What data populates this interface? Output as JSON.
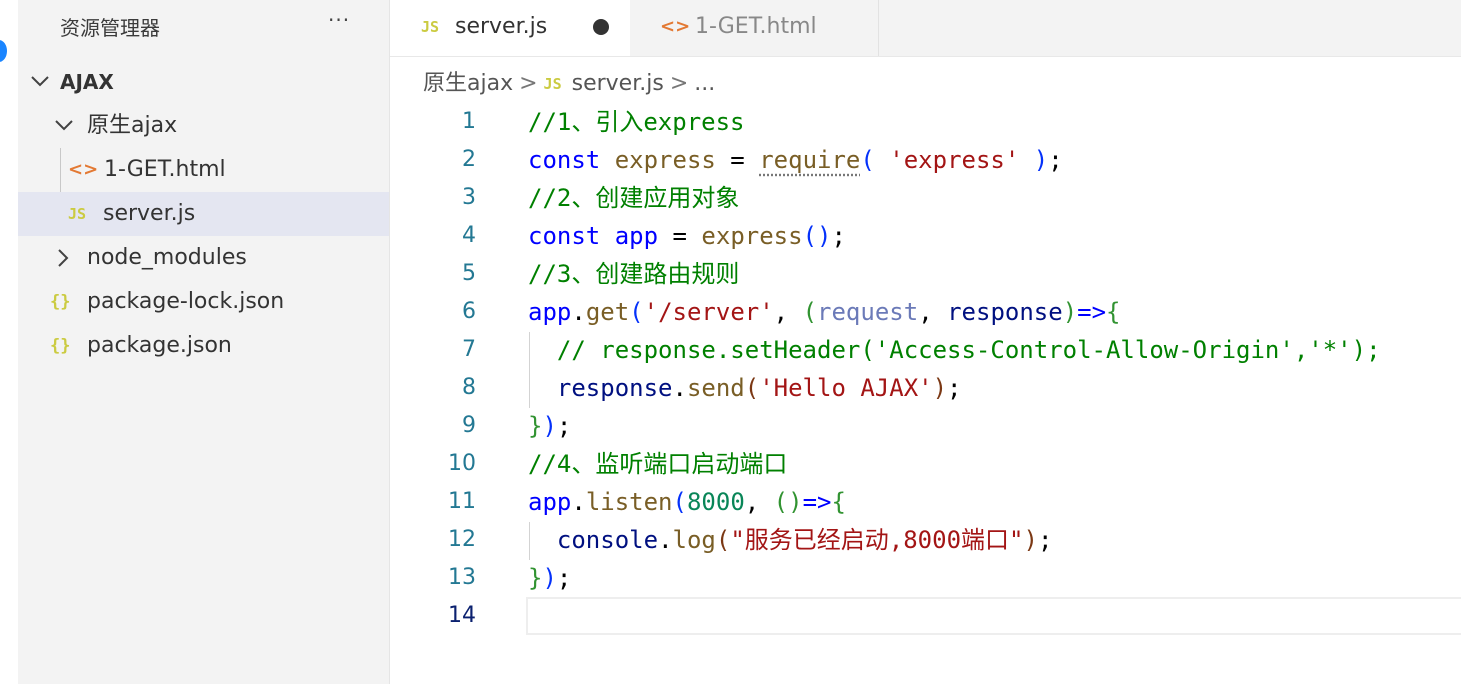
{
  "sidebar": {
    "title": "资源管理器",
    "more_label": "···",
    "tree": [
      {
        "label": "AJAX",
        "kind": "root-folder",
        "expanded": true
      },
      {
        "label": "原生ajax",
        "kind": "folder",
        "expanded": true
      },
      {
        "label": "1-GET.html",
        "kind": "file",
        "icon": "html-icon",
        "icon_glyph": "<>"
      },
      {
        "label": "server.js",
        "kind": "file",
        "icon": "js-icon",
        "icon_glyph": "JS",
        "selected": true
      },
      {
        "label": "node_modules",
        "kind": "folder",
        "expanded": false
      },
      {
        "label": "package-lock.json",
        "kind": "file",
        "icon": "json-icon",
        "icon_glyph": "{}"
      },
      {
        "label": "package.json",
        "kind": "file",
        "icon": "json-icon",
        "icon_glyph": "{}"
      }
    ]
  },
  "tabs": [
    {
      "label": "server.js",
      "icon_glyph": "JS",
      "active": true,
      "dirty": true
    },
    {
      "label": "1-GET.html",
      "icon_glyph": "<>",
      "active": false
    }
  ],
  "breadcrumb": {
    "folder": "原生ajax",
    "file_icon": "JS",
    "file": "server.js",
    "more": "..."
  },
  "editor": {
    "active_line": 14,
    "lines": [
      {
        "n": "1",
        "tokens": [
          [
            "c",
            "//1、引入express"
          ]
        ]
      },
      {
        "n": "2",
        "tokens": [
          [
            "k",
            "const"
          ],
          [
            "p",
            " "
          ],
          [
            "f",
            "express"
          ],
          [
            "p",
            " = "
          ],
          [
            "fsq",
            "require"
          ],
          [
            "b1",
            "("
          ],
          [
            "p",
            " "
          ],
          [
            "s",
            "'express'"
          ],
          [
            "p",
            " "
          ],
          [
            "b1",
            ")"
          ],
          [
            "p",
            ";"
          ]
        ]
      },
      {
        "n": "3",
        "tokens": [
          [
            "c",
            "//2、创建应用对象"
          ]
        ]
      },
      {
        "n": "4",
        "tokens": [
          [
            "k",
            "const"
          ],
          [
            "p",
            " "
          ],
          [
            "vk",
            "app"
          ],
          [
            "p",
            " = "
          ],
          [
            "f",
            "express"
          ],
          [
            "b1",
            "()"
          ],
          [
            "p",
            ";"
          ]
        ]
      },
      {
        "n": "5",
        "tokens": [
          [
            "c",
            "//3、创建路由规则"
          ]
        ]
      },
      {
        "n": "6",
        "tokens": [
          [
            "vk",
            "app"
          ],
          [
            "p",
            "."
          ],
          [
            "f",
            "get"
          ],
          [
            "b1",
            "("
          ],
          [
            "s",
            "'/server'"
          ],
          [
            "p",
            ", "
          ],
          [
            "b2",
            "("
          ],
          [
            "vdim",
            "request"
          ],
          [
            "p",
            ", "
          ],
          [
            "v",
            "response"
          ],
          [
            "b2",
            ")"
          ],
          [
            "k",
            "=>"
          ],
          [
            "b2",
            "{"
          ]
        ]
      },
      {
        "n": "7",
        "tokens": [
          [
            "p",
            "  "
          ],
          [
            "c",
            "// response.setHeader('Access-Control-Allow-Origin','*');"
          ]
        ]
      },
      {
        "n": "8",
        "tokens": [
          [
            "p",
            "  "
          ],
          [
            "v",
            "response"
          ],
          [
            "p",
            "."
          ],
          [
            "f",
            "send"
          ],
          [
            "b3",
            "("
          ],
          [
            "s",
            "'Hello AJAX'"
          ],
          [
            "b3",
            ")"
          ],
          [
            "p",
            ";"
          ]
        ]
      },
      {
        "n": "9",
        "tokens": [
          [
            "b2",
            "}"
          ],
          [
            "b1",
            ")"
          ],
          [
            "p",
            ";"
          ]
        ]
      },
      {
        "n": "10",
        "tokens": [
          [
            "c",
            "//4、监听端口启动端口"
          ]
        ]
      },
      {
        "n": "11",
        "tokens": [
          [
            "vk",
            "app"
          ],
          [
            "p",
            "."
          ],
          [
            "f",
            "listen"
          ],
          [
            "b1",
            "("
          ],
          [
            "n",
            "8000"
          ],
          [
            "p",
            ", "
          ],
          [
            "b2",
            "()"
          ],
          [
            "k",
            "=>"
          ],
          [
            "b2",
            "{"
          ]
        ]
      },
      {
        "n": "12",
        "tokens": [
          [
            "p",
            "  "
          ],
          [
            "v",
            "console"
          ],
          [
            "p",
            "."
          ],
          [
            "f",
            "log"
          ],
          [
            "b3",
            "("
          ],
          [
            "s",
            "\"服务已经启动,8000端口\""
          ],
          [
            "b3",
            ")"
          ],
          [
            "p",
            ";"
          ]
        ]
      },
      {
        "n": "13",
        "tokens": [
          [
            "b2",
            "}"
          ],
          [
            "b1",
            ")"
          ],
          [
            "p",
            ";"
          ]
        ]
      },
      {
        "n": "14",
        "tokens": []
      }
    ]
  }
}
